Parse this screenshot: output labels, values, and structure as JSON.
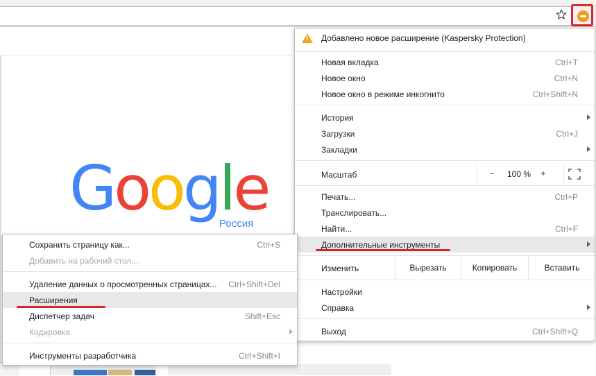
{
  "toolbar": {
    "kaspersky_button": "kaspersky-extension-icon"
  },
  "page": {
    "logo_letters": [
      {
        "ch": "G",
        "color": "#4285f4"
      },
      {
        "ch": "o",
        "color": "#ea4335"
      },
      {
        "ch": "o",
        "color": "#fbbc05"
      },
      {
        "ch": "g",
        "color": "#4285f4"
      },
      {
        "ch": "l",
        "color": "#34a853"
      },
      {
        "ch": "e",
        "color": "#ea4335"
      }
    ],
    "logo_region": "Россия"
  },
  "main_menu": {
    "notification": "Добавлено новое расширение (Kaspersky Protection)",
    "new_tab": {
      "label": "Новая вкладка",
      "shortcut": "Ctrl+T"
    },
    "new_window": {
      "label": "Новое окно",
      "shortcut": "Ctrl+N"
    },
    "incognito": {
      "label": "Новое окно в режиме инкогнито",
      "shortcut": "Ctrl+Shift+N"
    },
    "history": {
      "label": "История"
    },
    "downloads": {
      "label": "Загрузки",
      "shortcut": "Ctrl+J"
    },
    "bookmarks": {
      "label": "Закладки"
    },
    "zoom": {
      "label": "Масштаб",
      "minus": "−",
      "value": "100 %",
      "plus": "+"
    },
    "print": {
      "label": "Печать...",
      "shortcut": "Ctrl+P"
    },
    "cast": {
      "label": "Транслировать..."
    },
    "find": {
      "label": "Найти...",
      "shortcut": "Ctrl+F"
    },
    "more_tools": {
      "label": "Дополнительные инструменты"
    },
    "edit": {
      "label": "Изменить",
      "cut": "Вырезать",
      "copy": "Копировать",
      "paste": "Вставить"
    },
    "settings": {
      "label": "Настройки"
    },
    "help": {
      "label": "Справка"
    },
    "exit": {
      "label": "Выход",
      "shortcut": "Ctrl+Shift+Q"
    }
  },
  "sub_menu": {
    "save_page": {
      "label": "Сохранить страницу как...",
      "shortcut": "Ctrl+S"
    },
    "add_desktop": {
      "label": "Добавить на рабочий стол..."
    },
    "clear_data": {
      "label": "Удаление данных о просмотренных страницах...",
      "shortcut": "Ctrl+Shift+Del"
    },
    "extensions": {
      "label": "Расширения"
    },
    "task_manager": {
      "label": "Диспетчер задач",
      "shortcut": "Shift+Esc"
    },
    "encoding": {
      "label": "Кодировка"
    },
    "dev_tools": {
      "label": "Инструменты разработчика",
      "shortcut": "Ctrl+Shift+I"
    }
  },
  "colors": {
    "highlight_underline": "#d8232a",
    "warning": "#f4a51c",
    "kaspersky": "#f29a1e"
  }
}
